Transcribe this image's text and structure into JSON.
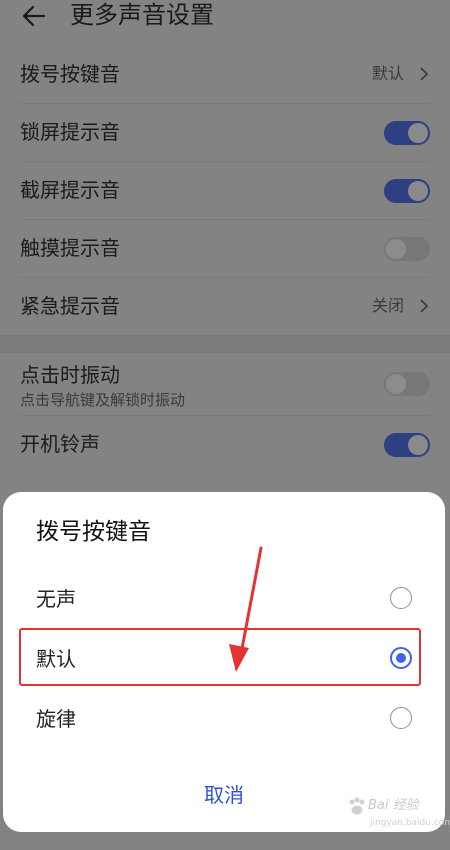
{
  "header": {
    "title": "更多声音设置"
  },
  "settings": [
    {
      "label": "拨号按键音",
      "value": "默认"
    },
    {
      "label": "锁屏提示音",
      "toggle": true
    },
    {
      "label": "截屏提示音",
      "toggle": true
    },
    {
      "label": "触摸提示音",
      "toggle": false
    },
    {
      "label": "紧急提示音",
      "value": "关闭"
    }
  ],
  "settings2": [
    {
      "label": "点击时振动",
      "subtitle": "点击导航键及解锁时振动",
      "toggle": false
    },
    {
      "label": "开机铃声",
      "toggle": true
    }
  ],
  "dialog": {
    "title": "拨号按键音",
    "options": [
      {
        "label": "无声",
        "selected": false
      },
      {
        "label": "默认",
        "selected": true
      },
      {
        "label": "旋律",
        "selected": false
      }
    ],
    "cancel": "取消"
  },
  "watermark": {
    "text": "Bai 经验",
    "sub": "jingyan.baidu.com"
  },
  "colors": {
    "accent": "#3f62f0",
    "highlight": "#e53232",
    "toggle_on": "#2e3f84"
  }
}
